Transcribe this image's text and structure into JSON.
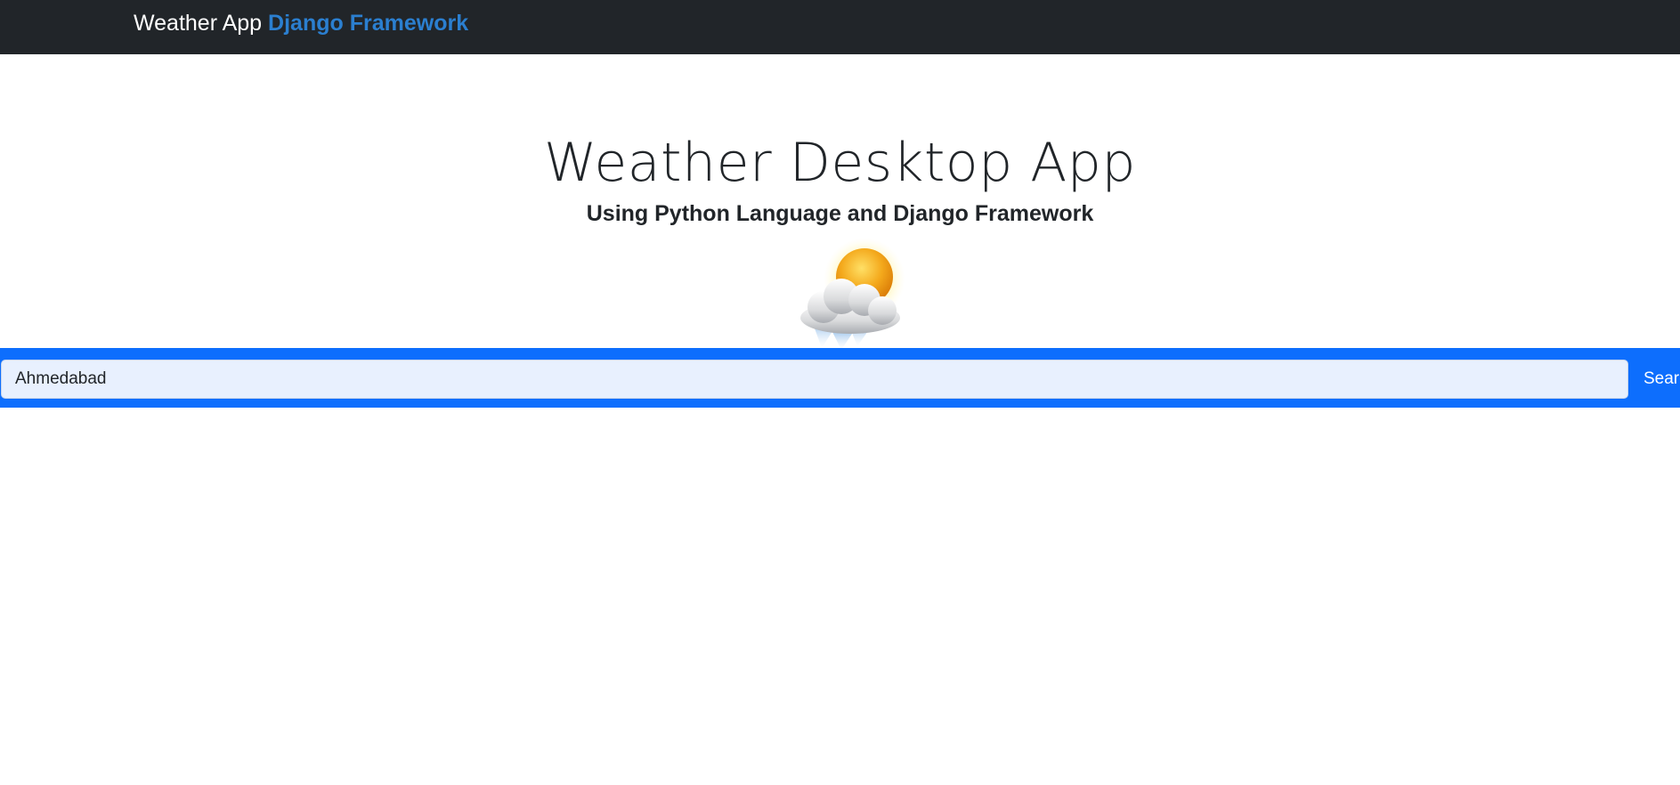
{
  "navbar": {
    "brand_text": "Weather App",
    "brand_accent": "Django Framework"
  },
  "hero": {
    "title": "Weather Desktop App",
    "subtitle": "Using Python Language and Django Framework",
    "icon": "sun-behind-rain-cloud-icon"
  },
  "search": {
    "value": "Ahmedabad",
    "button_label": "Search"
  },
  "colors": {
    "navbar_bg": "#212529",
    "brand_accent": "#2b7fd0",
    "search_band": "#0d6efd",
    "input_bg": "#e8f0fe"
  }
}
